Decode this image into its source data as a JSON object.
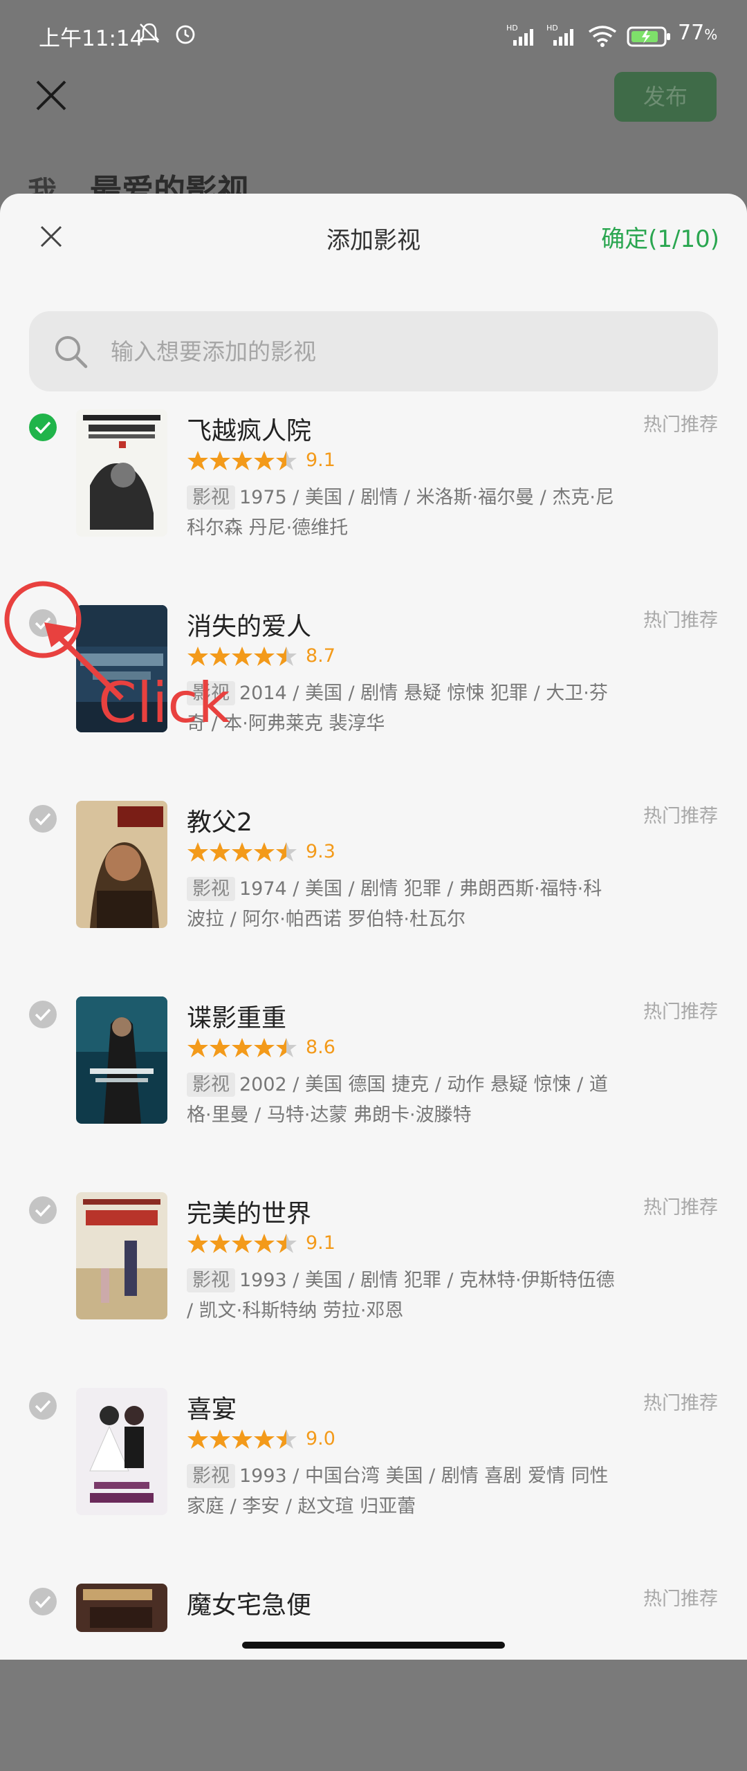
{
  "status_bar": {
    "time": "上午11:14",
    "battery_pct": "77"
  },
  "background": {
    "publish_label": "发布",
    "title": "最爱的影视",
    "title_icon_char": "我"
  },
  "sheet": {
    "title": "添加影视",
    "confirm_label": "确定(1/10)",
    "search_placeholder": "输入想要添加的影视"
  },
  "movies": [
    {
      "title": "飞越疯人院",
      "score": "9.1",
      "kind": "影视",
      "meta": "1975 / 美国 / 剧情 / 米洛斯·福尔曼 / 杰克·尼科尔森 丹尼·德维托",
      "tag": "热门推荐",
      "checked": true
    },
    {
      "title": "消失的爱人",
      "score": "8.7",
      "kind": "影视",
      "meta": "2014 / 美国 / 剧情 悬疑 惊悚 犯罪 / 大卫·芬奇 / 本·阿弗莱克 裴淳华",
      "tag": "热门推荐",
      "checked": false
    },
    {
      "title": "教父2",
      "score": "9.3",
      "kind": "影视",
      "meta": "1974 / 美国 / 剧情 犯罪 / 弗朗西斯·福特·科波拉 / 阿尔·帕西诺 罗伯特·杜瓦尔",
      "tag": "热门推荐",
      "checked": false
    },
    {
      "title": "谍影重重",
      "score": "8.6",
      "kind": "影视",
      "meta": "2002 / 美国 德国 捷克 / 动作 悬疑 惊悚 / 道格·里曼 / 马特·达蒙 弗朗卡·波滕特",
      "tag": "热门推荐",
      "checked": false
    },
    {
      "title": "完美的世界",
      "score": "9.1",
      "kind": "影视",
      "meta": "1993 / 美国 / 剧情 犯罪 / 克林特·伊斯特伍德 / 凯文·科斯特纳 劳拉·邓恩",
      "tag": "热门推荐",
      "checked": false
    },
    {
      "title": "喜宴",
      "score": "9.0",
      "kind": "影视",
      "meta": "1993 / 中国台湾 美国 / 剧情 喜剧 爱情 同性 家庭 / 李安 / 赵文瑄 归亚蕾",
      "tag": "热门推荐",
      "checked": false
    },
    {
      "title": "魔女宅急便",
      "score": "",
      "kind": "",
      "meta": "",
      "tag": "热门推荐",
      "checked": false
    }
  ],
  "annotation": {
    "label": "Click"
  }
}
